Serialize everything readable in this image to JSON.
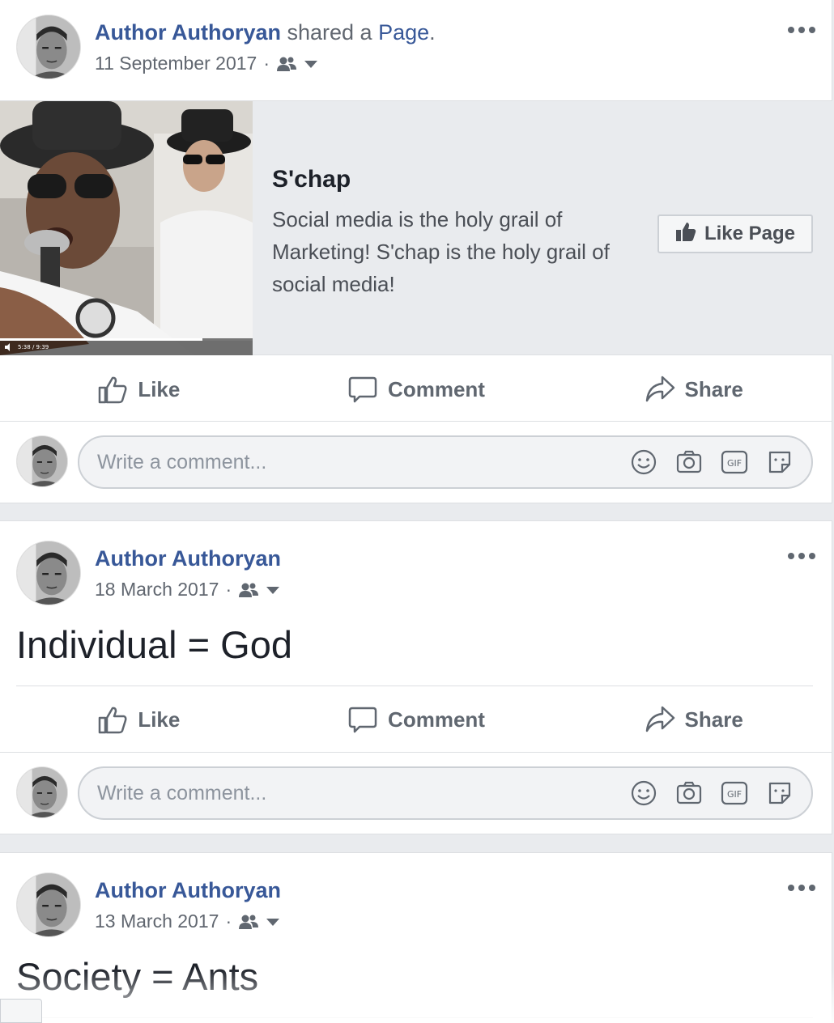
{
  "posts": [
    {
      "author": "Author Authoryan",
      "shared_text": " shared a ",
      "shared_link": "Page",
      "shared_period": ".",
      "date": "11 September 2017",
      "date_sep": "·",
      "audience_icon": "friends-icon",
      "shared_page": {
        "title": "S'chap",
        "description": "Social media is the holy grail of Marketing! S'chap is the holy grail of social media!",
        "like_page_label": "Like Page",
        "video_time": "5:38 / 9:39"
      }
    },
    {
      "author": "Author Authoryan",
      "date": "18 March 2017",
      "date_sep": "·",
      "audience_icon": "friends-icon",
      "text": "Individual = God"
    },
    {
      "author": "Author Authoryan",
      "date": "13 March 2017",
      "date_sep": "·",
      "audience_icon": "friends-icon",
      "text": "Society = Ants"
    }
  ],
  "actions": {
    "like": "Like",
    "comment": "Comment",
    "share": "Share"
  },
  "comment_box": {
    "placeholder": "Write a comment...",
    "icons": [
      "emoji-icon",
      "camera-icon",
      "gif-icon",
      "sticker-icon"
    ]
  },
  "colors": {
    "link": "#385898",
    "text_secondary": "#616770",
    "feed_bg": "#e9ebee"
  }
}
